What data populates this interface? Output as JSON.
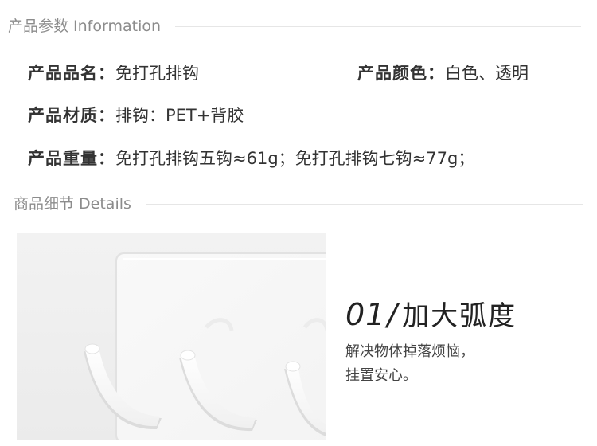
{
  "sections": {
    "info_title": "产品参数 Information",
    "details_title": "商品细节 Details"
  },
  "specs": {
    "name": {
      "label": "产品品名：",
      "value": "免打孔排钩"
    },
    "color": {
      "label": "产品颜色：",
      "value": "白色、透明"
    },
    "material": {
      "label": "产品材质：",
      "value": "排钩：PET+背胶"
    },
    "weight": {
      "label": "产品重量：",
      "value": "免打孔排钩五钩≈61g；免打孔排钩七钩≈77g；"
    }
  },
  "feature": {
    "number": "01",
    "slash": "/",
    "title": "加大弧度",
    "line1": "解决物体掉落烦恼，",
    "line2": "挂置安心。"
  },
  "colors": {
    "text": "#333333",
    "muted": "#8c8c8c",
    "rule": "#e6e6e6",
    "photo_bg": "#eeeeee",
    "product": "#ffffff"
  }
}
